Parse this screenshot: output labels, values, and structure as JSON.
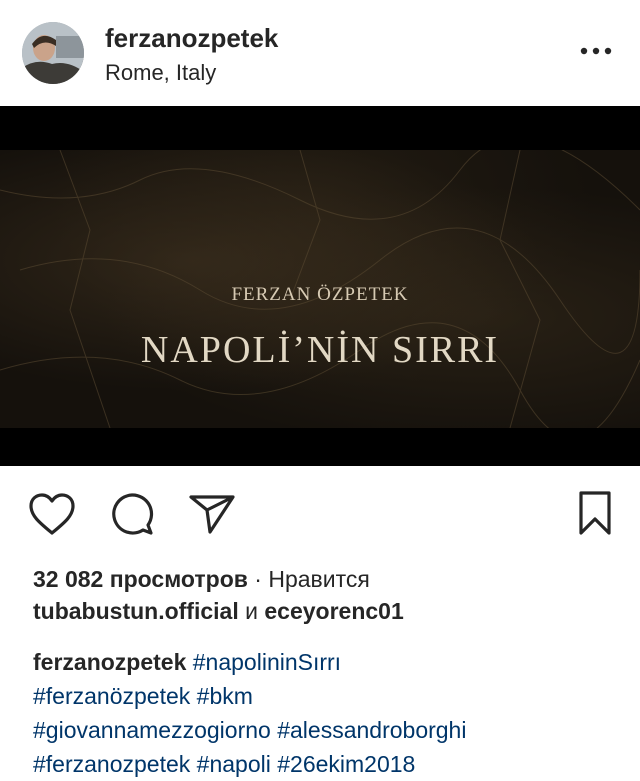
{
  "post": {
    "username": "ferzanozpetek",
    "location": "Rome, Italy"
  },
  "media": {
    "director": "FERZAN ÖZPETEK",
    "title": "NAPOLİ’NİN SIRRI"
  },
  "actions": {
    "icons": [
      "heart-icon",
      "comment-icon",
      "share-icon",
      "bookmark-icon"
    ]
  },
  "stats": {
    "views_count": "32 082 просмотров",
    "separator": " · ",
    "likes_prefix": "Нравится",
    "liker1": "tubabustun.official",
    "conjunction": " и ",
    "liker2": "eceyorenc01"
  },
  "caption": {
    "username": "ferzanozpetek",
    "tags": [
      "#napolininSırrı",
      "#ferzanözpetek",
      "#bkm",
      "#giovannamezzogiorno",
      "#alessandroborghi",
      "#ferzanozpetek",
      "#napoli",
      "#26ekim2018"
    ]
  }
}
